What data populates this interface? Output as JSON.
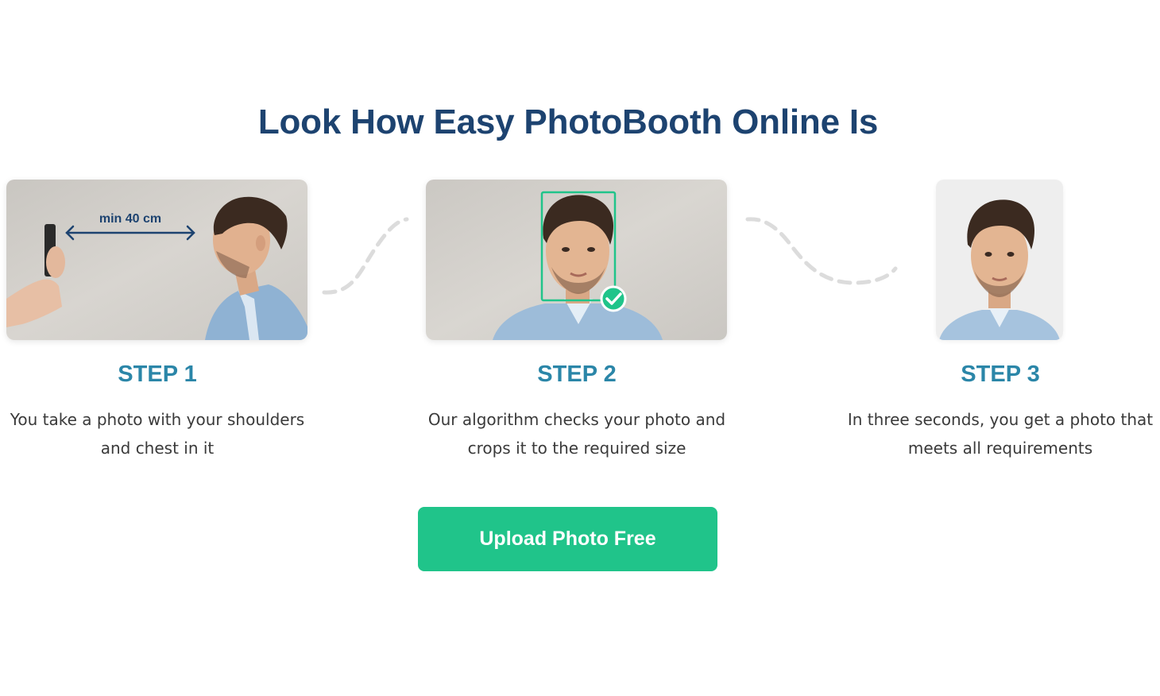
{
  "section": {
    "title": "Look How Easy PhotoBooth Online Is"
  },
  "steps": [
    {
      "title": "STEP 1",
      "description": "You take a photo with your shoulders and chest in it",
      "image_label": "min 40 cm"
    },
    {
      "title": "STEP 2",
      "description": "Our algorithm checks your photo and crops it to the required size"
    },
    {
      "title": "STEP 3",
      "description": "In three seconds, you get a photo that meets all requirements"
    }
  ],
  "cta": {
    "label": "Upload Photo Free"
  },
  "colors": {
    "heading": "#1d4370",
    "step_title": "#2b86a8",
    "button": "#20c48a",
    "check": "#20c48a",
    "connector": "#d9d9d9"
  },
  "icons": [
    "double-arrow-icon",
    "smartphone-icon",
    "check-circle-icon"
  ]
}
